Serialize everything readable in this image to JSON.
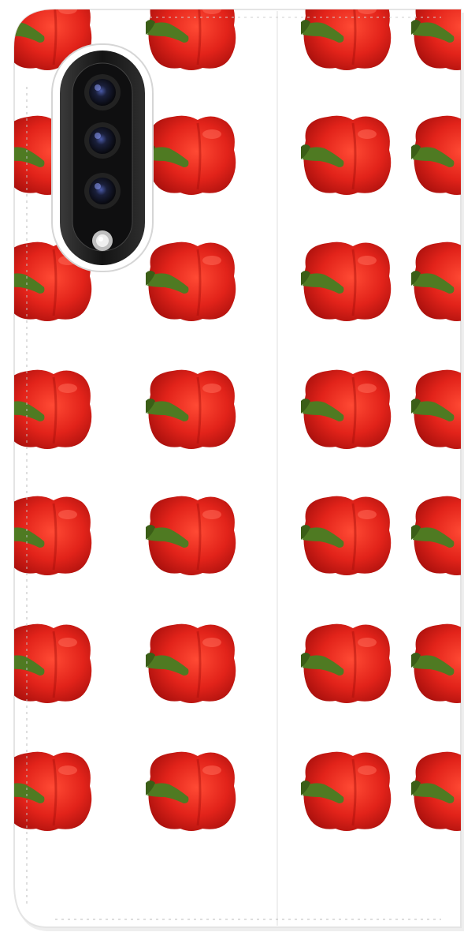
{
  "product": {
    "kind": "phone-wallet-case",
    "pattern": "red-bell-pepper",
    "colors": {
      "background": "#ffffff",
      "case_face": "#ffffff",
      "case_edge": "#e4e4e4",
      "stitching": "#bdbdbd",
      "pepper_red": "#e2231a",
      "pepper_dark": "#a60f0c",
      "pepper_highlight": "#ff6a57",
      "stem_green": "#4f7a22",
      "camera_body": "#1c1c1c",
      "lens": "#0d0f1a",
      "flash": "#d9d9d9"
    }
  },
  "camera": {
    "lens_count": 3,
    "has_flash": true
  },
  "pattern_grid": {
    "rows": 7,
    "columns": 4
  }
}
